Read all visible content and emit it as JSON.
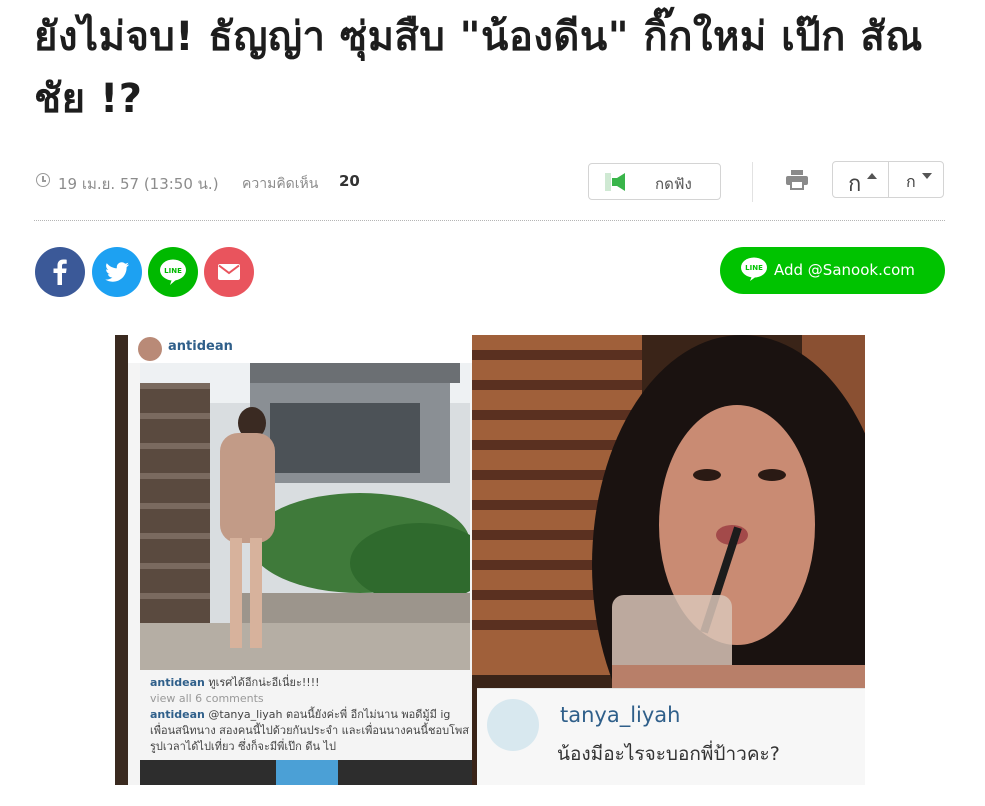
{
  "article": {
    "title": "ยังไม่จบ! ธัญญ่า ซุ่มสืบ \"น้องดีน\" กิ๊กใหม่ เป๊ก สัณชัย !?",
    "date": "19 เม.ย. 57 (13:50 น.)",
    "comments_label": "ความคิดเห็น",
    "comments_count": "20"
  },
  "toolbar": {
    "listen_label": "กดฟัง",
    "font_increase_label": "ก",
    "font_decrease_label": "ก"
  },
  "share": {
    "line_badge": "LINE",
    "add_line_label": "Add @Sanook.com"
  },
  "image": {
    "ig_username": "antidean",
    "caption_line1_user": "antidean",
    "caption_line1_text": "ทูเรศได้อีกน่ะอีเนี่ยะ!!!!",
    "view_comments": "view all 6 comments",
    "caption_line2_user": "antidean",
    "caption_line2_text": "@tanya_liyah ตอนนี้ยังค่ะพี่ อีกไม่นาน พอดีมู้มี ig เพื่อนสนิทนาง สองคนนี้ไปด้วยกันประจำ และเพื่อนนางคนนี้ชอบโพสรูปเวลาได้ไปเที่ยว ซึ่งก็จะมีพี่เป๊ก ดีน ไป",
    "tag_username": "tanya_liyah",
    "tag_text": "น้องมีอะไรจะบอกพี่ป้าวคะ?"
  },
  "colors": {
    "facebook": "#3b5998",
    "twitter": "#1da1f2",
    "line": "#00b900",
    "mail": "#e9545d",
    "add_line": "#00c300"
  },
  "icons": [
    "clock-icon",
    "speaker-icon",
    "print-icon",
    "facebook-icon",
    "twitter-icon",
    "line-icon",
    "mail-icon"
  ]
}
